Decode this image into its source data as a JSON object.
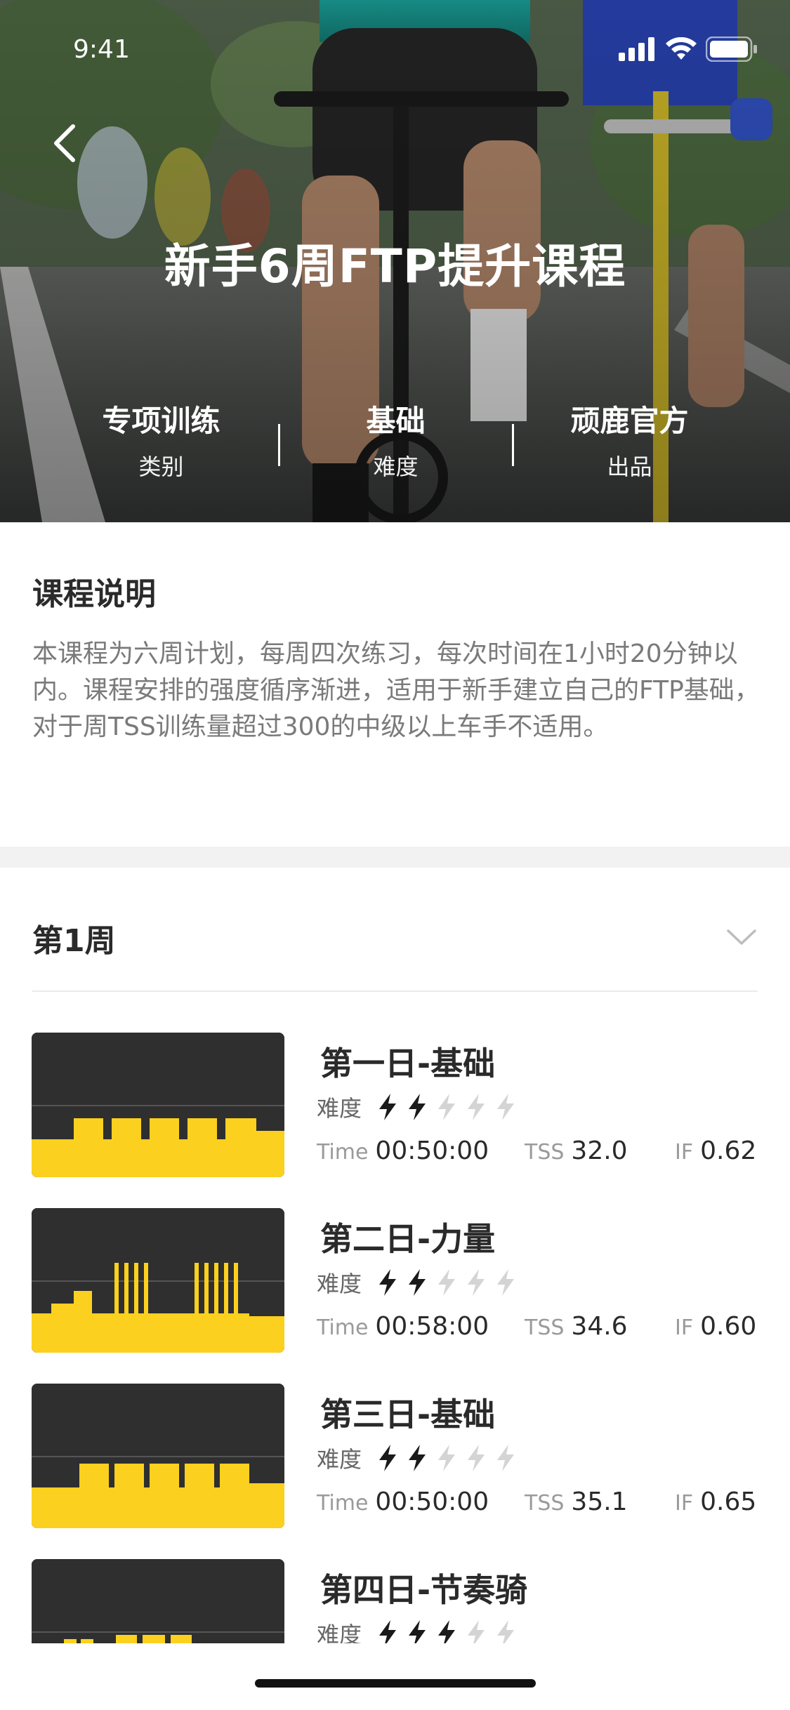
{
  "status_bar": {
    "time": "9:41"
  },
  "hero": {
    "title": "新手6周FTP提升课程",
    "stats": [
      {
        "value": "专项训练",
        "label": "类别"
      },
      {
        "value": "基础",
        "label": "难度"
      },
      {
        "value": "顽鹿官方",
        "label": "出品"
      }
    ]
  },
  "description": {
    "title": "课程说明",
    "text": "本课程为六周计划，每周四次练习，每次时间在1小时20分钟以内。课程安排的强度循序渐进，适用于新手建立自己的FTP基础，对于周TSS训练量超过300的中级以上车手不适用。"
  },
  "week": {
    "title": "第1周",
    "difficulty_label": "难度",
    "time_label": "Time",
    "tss_label": "TSS",
    "if_label": "IF",
    "workouts": [
      {
        "title": "第一日-基础",
        "difficulty": 2,
        "time": "00:50:00",
        "tss": "32.0",
        "if": "0.62"
      },
      {
        "title": "第二日-力量",
        "difficulty": 2,
        "time": "00:58:00",
        "tss": "34.6",
        "if": "0.60"
      },
      {
        "title": "第三日-基础",
        "difficulty": 2,
        "time": "00:50:00",
        "tss": "35.1",
        "if": "0.65"
      },
      {
        "title": "第四日-节奏骑",
        "difficulty": 3,
        "time": "",
        "tss": "",
        "if": ""
      }
    ]
  },
  "colors": {
    "accent_yellow": "#FCD01E",
    "thumb_bg": "#2F2F2F",
    "bolt_active": "#1A1A1A",
    "bolt_inactive": "#D4D4D4"
  }
}
